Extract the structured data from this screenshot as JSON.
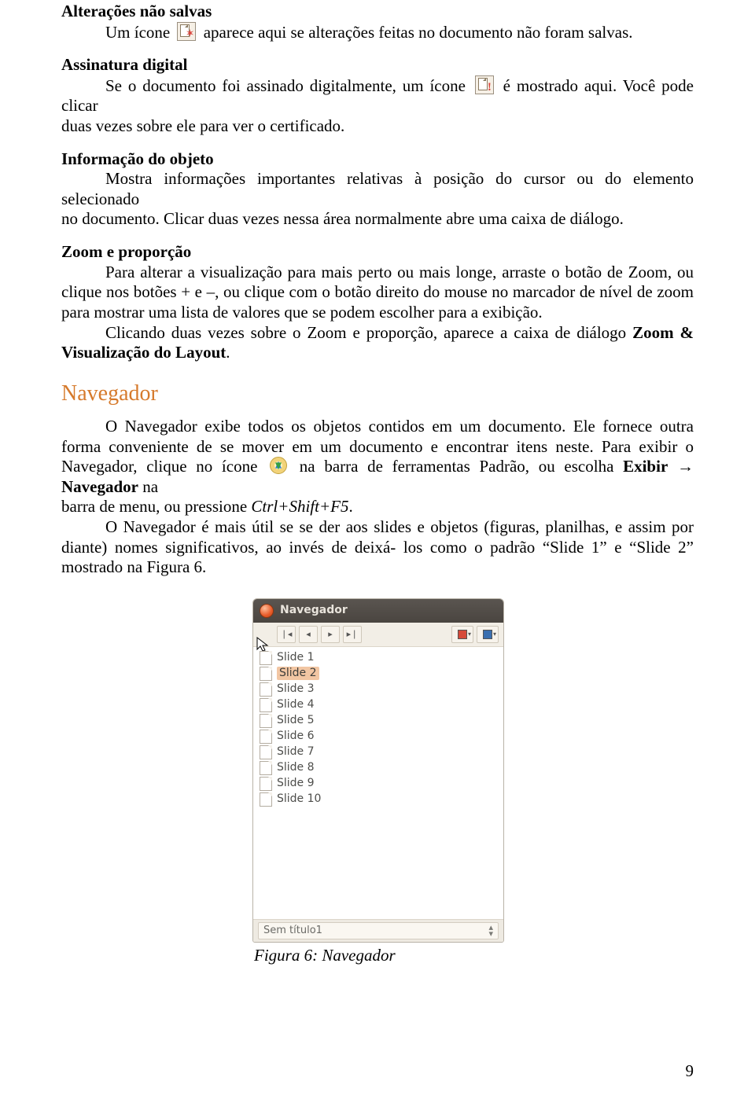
{
  "sections": {
    "alteracoes": {
      "heading": "Alterações não salvas",
      "line1_a": "Um ícone",
      "line1_b": "aparece aqui se alterações feitas no documento não foram salvas."
    },
    "assinatura": {
      "heading": "Assinatura digital",
      "line1_a": "Se o documento foi assinado digitalmente, um ícone",
      "line1_b": "é mostrado aqui. Você pode clicar",
      "line2": "duas vezes sobre ele para ver o certificado."
    },
    "informacao": {
      "heading": "Informação do objeto",
      "line1": "Mostra informações importantes relativas à posição do cursor ou do elemento selecionado",
      "line2": "no documento. Clicar duas vezes nessa área normalmente abre uma caixa de diálogo."
    },
    "zoom": {
      "heading": "Zoom e proporção",
      "para1": "Para alterar a visualização para mais perto ou mais longe, arraste o botão de Zoom, ou clique nos botões + e –, ou clique com o botão direito do mouse no marcador de nível de zoom para mostrar uma lista de valores que se podem escolher para a exibição.",
      "para2_a": "Clicando duas vezes sobre o Zoom e proporção, aparece a caixa de diálogo ",
      "para2_b": "Zoom & Visualização do Layout",
      "para2_c": "."
    }
  },
  "navegador": {
    "heading": "Navegador",
    "para1_a": "O Navegador exibe todos os objetos contidos em um documento. Ele fornece outra forma conveniente de se mover em um documento e encontrar itens neste. Para exibir o Navegador, clique no ícone ",
    "para1_b": " na barra de ferramentas Padrão, ou escolha ",
    "para1_menu_a": "Exibir",
    "para1_arrow": " → ",
    "para1_menu_b": "Navegador",
    "para1_c": " na",
    "line_next": "barra de menu, ou pressione ",
    "shortcut": "Ctrl+Shift+F5",
    "line_next_end": ".",
    "para2": "O Navegador é mais útil se se der aos slides e objetos (figuras, planilhas, e assim por diante) nomes significativos, ao invés de deixá- los como o padrão “Slide 1” e “Slide 2” mostrado na Figura 6."
  },
  "nav_window": {
    "title": "Navegador",
    "slides": [
      "Slide 1",
      "Slide 2",
      "Slide 3",
      "Slide 4",
      "Slide 5",
      "Slide 6",
      "Slide 7",
      "Slide 8",
      "Slide 9",
      "Slide 10"
    ],
    "selected_index": 1,
    "status": "Sem título1",
    "colors": [
      "#d64a3a",
      "#3a6fb0"
    ]
  },
  "caption": "Figura 6: Navegador",
  "page_number": "9"
}
